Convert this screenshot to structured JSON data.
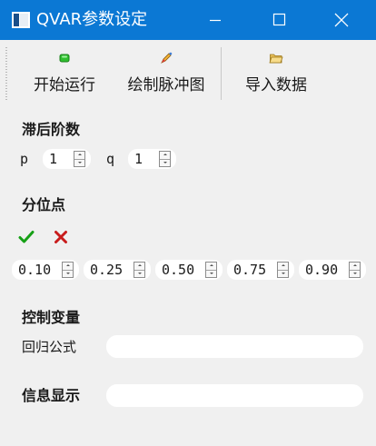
{
  "window": {
    "title": "QVAR参数设定",
    "icons": {
      "app": "app-window-icon",
      "minimize": "minimize-icon",
      "maximize": "maximize-icon",
      "close": "close-icon"
    }
  },
  "toolbar": {
    "start": {
      "label": "开始运行",
      "icon": "green-run-icon"
    },
    "draw": {
      "label": "绘制脉冲图",
      "icon": "pencil-draw-icon"
    },
    "import": {
      "label": "导入数据",
      "icon": "folder-open-icon"
    }
  },
  "lag_order": {
    "heading": "滞后阶数",
    "p_label": "p",
    "p_value": "1",
    "q_label": "q",
    "q_value": "1"
  },
  "quantiles": {
    "heading": "分位点",
    "select_all_icon": "green-checkmark-icon",
    "clear_icon": "red-cross-icon",
    "values": [
      "0.10",
      "0.25",
      "0.50",
      "0.75",
      "0.90"
    ]
  },
  "control": {
    "heading": "控制变量",
    "formula_label": "回归公式",
    "formula_value": ""
  },
  "info": {
    "heading": "信息显示",
    "value": ""
  },
  "colors": {
    "titlebar": "#0b78d4",
    "background": "#f0f0f0",
    "field": "#ffffff"
  }
}
